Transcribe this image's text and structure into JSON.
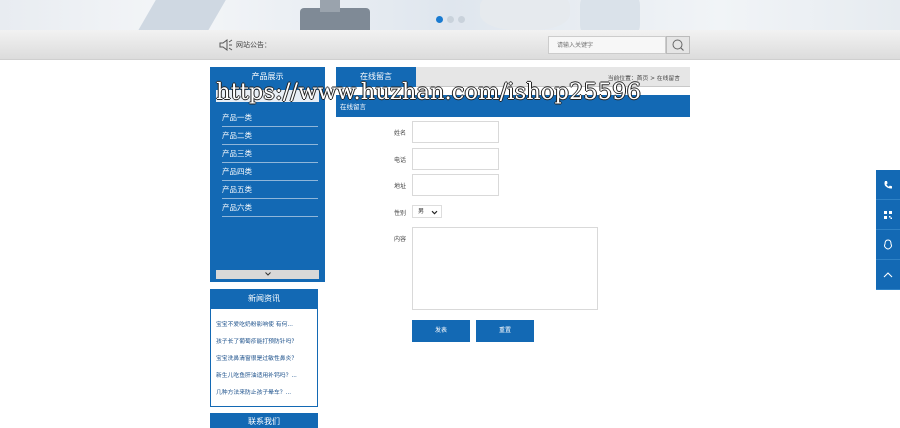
{
  "slider": {
    "dot_count": 3,
    "active_index": 0
  },
  "notice": {
    "label": "网站公告："
  },
  "search": {
    "placeholder": "请输入关键字"
  },
  "sidebar_products": {
    "title": "产品展示",
    "items": [
      "产品一类",
      "产品二类",
      "产品三类",
      "产品四类",
      "产品五类",
      "产品六类"
    ]
  },
  "news": {
    "title": "新闻资讯",
    "items": [
      "宝宝不爱吃奶粉影响使 有何...",
      "孩子长了葡萄疹能打预防针吗？",
      "宝宝洗鼻清窗很是过敏性鼻炎？",
      "新生儿吃鱼肝油适用补钙吗？...",
      "几种方法来防止孩子晕车？..."
    ]
  },
  "contact": {
    "title": "联系我们"
  },
  "main": {
    "tab": "在线留言",
    "breadcrumb": "当前位置：首页 > 在线留言",
    "banner": "在线留言"
  },
  "watermark": "https://www.huzhan.com/ishop25596",
  "form": {
    "name_label": "姓名",
    "phone_label": "电话",
    "address_label": "地址",
    "gender_label": "性别",
    "gender_value": "男",
    "content_label": "内容",
    "submit": "发表",
    "reset": "重置"
  },
  "colors": {
    "brand": "#1369b4"
  }
}
